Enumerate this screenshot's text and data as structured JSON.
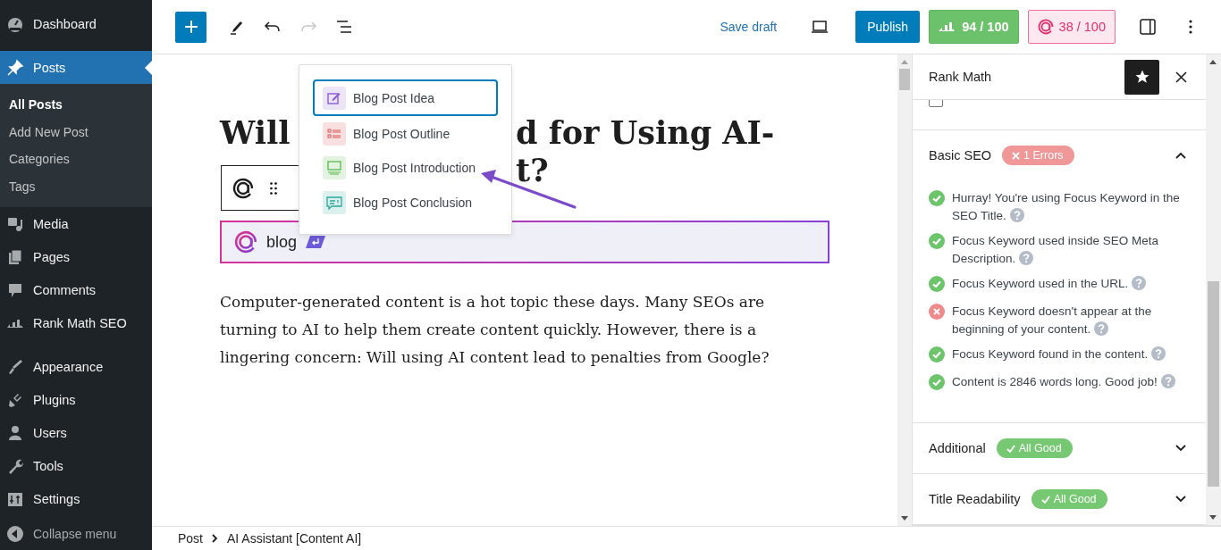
{
  "admin_menu": {
    "groups": [
      [
        {
          "label": "Dashboard",
          "kind": "dashboard",
          "selected": false
        }
      ],
      [
        {
          "label": "Posts",
          "kind": "posts",
          "selected": true,
          "children": [
            {
              "label": "All Posts",
              "selected": true
            },
            {
              "label": "Add New Post",
              "selected": false
            },
            {
              "label": "Categories",
              "selected": false
            },
            {
              "label": "Tags",
              "selected": false
            }
          ]
        },
        {
          "label": "Media",
          "kind": "media",
          "selected": false
        },
        {
          "label": "Pages",
          "kind": "pages",
          "selected": false
        },
        {
          "label": "Comments",
          "kind": "comments",
          "selected": false
        },
        {
          "label": "Rank Math SEO",
          "kind": "rankmath",
          "selected": false
        }
      ],
      [
        {
          "label": "Appearance",
          "kind": "appearance",
          "selected": false
        },
        {
          "label": "Plugins",
          "kind": "plugins",
          "selected": false
        },
        {
          "label": "Users",
          "kind": "users",
          "selected": false
        },
        {
          "label": "Tools",
          "kind": "tools",
          "selected": false
        },
        {
          "label": "Settings",
          "kind": "settings",
          "selected": false
        }
      ]
    ],
    "collapse": "Collapse menu"
  },
  "toolbar": {
    "left": [
      {
        "kind": "add",
        "disabled": false
      },
      {
        "kind": "edit",
        "disabled": false
      },
      {
        "kind": "undo",
        "disabled": false
      },
      {
        "kind": "redo",
        "disabled": true
      },
      {
        "kind": "list_view",
        "disabled": false
      }
    ],
    "save_draft": "Save draft",
    "publish": "Publish",
    "seo_score": "94 / 100",
    "content_ai_score": "38 / 100"
  },
  "editor": {
    "title_line_1": [
      "Will",
      "d for Using AI-"
    ],
    "title_line_2": [
      "t?"
    ],
    "popover": [
      {
        "label": "Blog Post Idea",
        "kind": "idea",
        "selected": true
      },
      {
        "label": "Blog Post Outline",
        "kind": "outline",
        "selected": false
      },
      {
        "label": "Blog Post Introduction",
        "kind": "introduction",
        "selected": false
      },
      {
        "label": "Blog Post Conclusion",
        "kind": "conclusion",
        "selected": false
      }
    ],
    "ai_prompt": {
      "value": "blog"
    },
    "paragraph": "Computer-generated content is a hot topic these days. Many SEOs are turning to AI to help them create content quickly. However, there is a lingering concern: Will using AI content lead to penalties from Google?"
  },
  "breadcrumb": [
    "Post",
    "AI Assistant [Content AI]"
  ],
  "panel": {
    "title": "Rank Math",
    "pillar_checked": false,
    "sections": [
      {
        "title": "Basic SEO",
        "badge": "1 Errors",
        "passed": false,
        "expanded": true,
        "checks": [
          {
            "text": "Hurray! You're using Focus Keyword in the SEO Title.",
            "passed": true
          },
          {
            "text": "Focus Keyword used inside SEO Meta Description.",
            "passed": true
          },
          {
            "text": "Focus Keyword used in the URL.",
            "passed": true
          },
          {
            "text": "Focus Keyword doesn't appear at the beginning of your content.",
            "passed": false
          },
          {
            "text": "Focus Keyword found in the content.",
            "passed": true
          },
          {
            "text": "Content is 2846 words long. Good job!",
            "passed": true
          }
        ]
      },
      {
        "title": "Additional",
        "badge": "All Good",
        "passed": true,
        "expanded": false
      },
      {
        "title": "Title Readability",
        "badge": "All Good",
        "passed": true,
        "expanded": false
      }
    ]
  }
}
